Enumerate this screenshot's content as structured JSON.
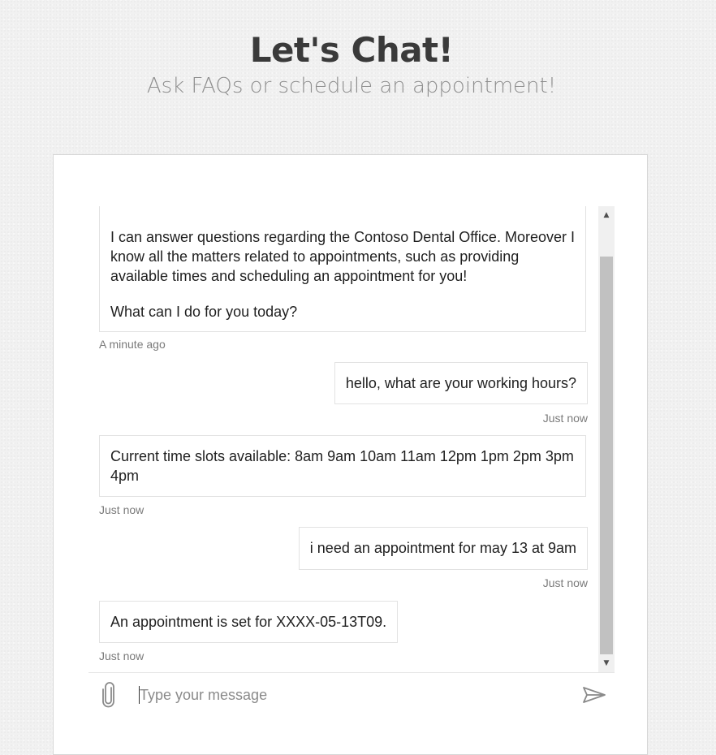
{
  "header": {
    "title": "Let's Chat!",
    "subtitle": "Ask FAQs or schedule an appointment!"
  },
  "messages": [
    {
      "from": "bot",
      "paragraphs": [
        "I can answer questions regarding the Contoso Dental Office. Moreover I know all the matters related to appointments, such as providing available times and scheduling an appointment for you!",
        "What can I do for you today?"
      ],
      "timestamp": "A minute ago"
    },
    {
      "from": "user",
      "text": "hello, what are your working hours?",
      "timestamp": "Just now"
    },
    {
      "from": "bot",
      "text": "Current time slots available: 8am 9am 10am 11am 12pm 1pm 2pm 3pm 4pm",
      "timestamp": "Just now"
    },
    {
      "from": "user",
      "text": "i need an appointment for may 13 at 9am",
      "timestamp": "Just now"
    },
    {
      "from": "bot",
      "text": "An appointment is set for XXXX-05-13T09.",
      "timestamp": "Just now"
    }
  ],
  "composer": {
    "placeholder": "Type your message",
    "value": ""
  },
  "icons": {
    "attach": "paperclip-icon",
    "send": "send-icon",
    "scroll_up": "chevron-up-icon",
    "scroll_down": "chevron-down-icon"
  },
  "colors": {
    "background": "#f1f1f1",
    "card": "#ffffff",
    "title": "#3a3a3a",
    "subtitle": "#8f8f8f",
    "bubble_border": "#e2e2e2",
    "timestamp": "#7a7a7a",
    "scroll_thumb": "#c1c1c1"
  }
}
